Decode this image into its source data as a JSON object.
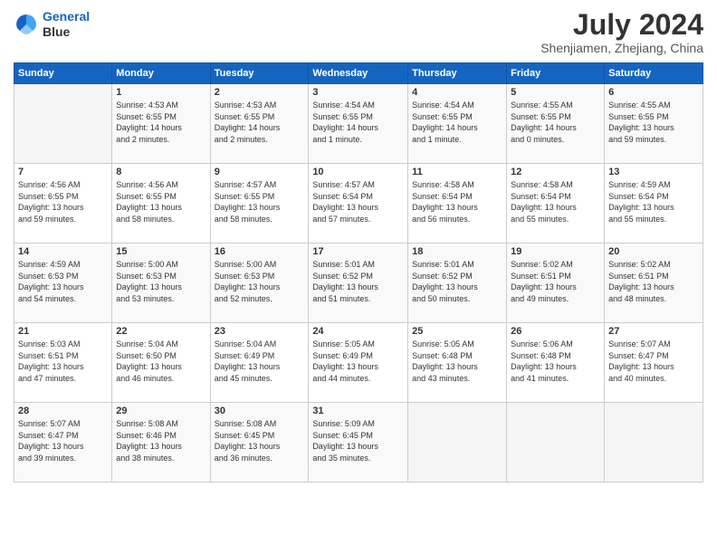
{
  "header": {
    "logo_line1": "General",
    "logo_line2": "Blue",
    "title": "July 2024",
    "location": "Shenjiamen, Zhejiang, China"
  },
  "weekdays": [
    "Sunday",
    "Monday",
    "Tuesday",
    "Wednesday",
    "Thursday",
    "Friday",
    "Saturday"
  ],
  "weeks": [
    [
      {
        "day": "",
        "info": ""
      },
      {
        "day": "1",
        "info": "Sunrise: 4:53 AM\nSunset: 6:55 PM\nDaylight: 14 hours\nand 2 minutes."
      },
      {
        "day": "2",
        "info": "Sunrise: 4:53 AM\nSunset: 6:55 PM\nDaylight: 14 hours\nand 2 minutes."
      },
      {
        "day": "3",
        "info": "Sunrise: 4:54 AM\nSunset: 6:55 PM\nDaylight: 14 hours\nand 1 minute."
      },
      {
        "day": "4",
        "info": "Sunrise: 4:54 AM\nSunset: 6:55 PM\nDaylight: 14 hours\nand 1 minute."
      },
      {
        "day": "5",
        "info": "Sunrise: 4:55 AM\nSunset: 6:55 PM\nDaylight: 14 hours\nand 0 minutes."
      },
      {
        "day": "6",
        "info": "Sunrise: 4:55 AM\nSunset: 6:55 PM\nDaylight: 13 hours\nand 59 minutes."
      }
    ],
    [
      {
        "day": "7",
        "info": "Sunrise: 4:56 AM\nSunset: 6:55 PM\nDaylight: 13 hours\nand 59 minutes."
      },
      {
        "day": "8",
        "info": "Sunrise: 4:56 AM\nSunset: 6:55 PM\nDaylight: 13 hours\nand 58 minutes."
      },
      {
        "day": "9",
        "info": "Sunrise: 4:57 AM\nSunset: 6:55 PM\nDaylight: 13 hours\nand 58 minutes."
      },
      {
        "day": "10",
        "info": "Sunrise: 4:57 AM\nSunset: 6:54 PM\nDaylight: 13 hours\nand 57 minutes."
      },
      {
        "day": "11",
        "info": "Sunrise: 4:58 AM\nSunset: 6:54 PM\nDaylight: 13 hours\nand 56 minutes."
      },
      {
        "day": "12",
        "info": "Sunrise: 4:58 AM\nSunset: 6:54 PM\nDaylight: 13 hours\nand 55 minutes."
      },
      {
        "day": "13",
        "info": "Sunrise: 4:59 AM\nSunset: 6:54 PM\nDaylight: 13 hours\nand 55 minutes."
      }
    ],
    [
      {
        "day": "14",
        "info": "Sunrise: 4:59 AM\nSunset: 6:53 PM\nDaylight: 13 hours\nand 54 minutes."
      },
      {
        "day": "15",
        "info": "Sunrise: 5:00 AM\nSunset: 6:53 PM\nDaylight: 13 hours\nand 53 minutes."
      },
      {
        "day": "16",
        "info": "Sunrise: 5:00 AM\nSunset: 6:53 PM\nDaylight: 13 hours\nand 52 minutes."
      },
      {
        "day": "17",
        "info": "Sunrise: 5:01 AM\nSunset: 6:52 PM\nDaylight: 13 hours\nand 51 minutes."
      },
      {
        "day": "18",
        "info": "Sunrise: 5:01 AM\nSunset: 6:52 PM\nDaylight: 13 hours\nand 50 minutes."
      },
      {
        "day": "19",
        "info": "Sunrise: 5:02 AM\nSunset: 6:51 PM\nDaylight: 13 hours\nand 49 minutes."
      },
      {
        "day": "20",
        "info": "Sunrise: 5:02 AM\nSunset: 6:51 PM\nDaylight: 13 hours\nand 48 minutes."
      }
    ],
    [
      {
        "day": "21",
        "info": "Sunrise: 5:03 AM\nSunset: 6:51 PM\nDaylight: 13 hours\nand 47 minutes."
      },
      {
        "day": "22",
        "info": "Sunrise: 5:04 AM\nSunset: 6:50 PM\nDaylight: 13 hours\nand 46 minutes."
      },
      {
        "day": "23",
        "info": "Sunrise: 5:04 AM\nSunset: 6:49 PM\nDaylight: 13 hours\nand 45 minutes."
      },
      {
        "day": "24",
        "info": "Sunrise: 5:05 AM\nSunset: 6:49 PM\nDaylight: 13 hours\nand 44 minutes."
      },
      {
        "day": "25",
        "info": "Sunrise: 5:05 AM\nSunset: 6:48 PM\nDaylight: 13 hours\nand 43 minutes."
      },
      {
        "day": "26",
        "info": "Sunrise: 5:06 AM\nSunset: 6:48 PM\nDaylight: 13 hours\nand 41 minutes."
      },
      {
        "day": "27",
        "info": "Sunrise: 5:07 AM\nSunset: 6:47 PM\nDaylight: 13 hours\nand 40 minutes."
      }
    ],
    [
      {
        "day": "28",
        "info": "Sunrise: 5:07 AM\nSunset: 6:47 PM\nDaylight: 13 hours\nand 39 minutes."
      },
      {
        "day": "29",
        "info": "Sunrise: 5:08 AM\nSunset: 6:46 PM\nDaylight: 13 hours\nand 38 minutes."
      },
      {
        "day": "30",
        "info": "Sunrise: 5:08 AM\nSunset: 6:45 PM\nDaylight: 13 hours\nand 36 minutes."
      },
      {
        "day": "31",
        "info": "Sunrise: 5:09 AM\nSunset: 6:45 PM\nDaylight: 13 hours\nand 35 minutes."
      },
      {
        "day": "",
        "info": ""
      },
      {
        "day": "",
        "info": ""
      },
      {
        "day": "",
        "info": ""
      }
    ]
  ]
}
